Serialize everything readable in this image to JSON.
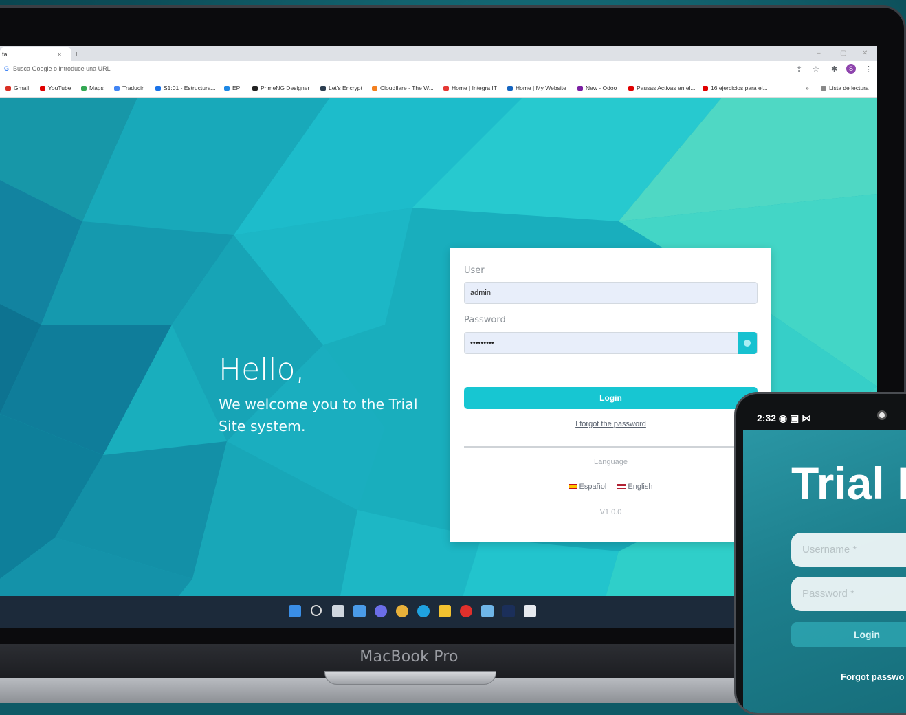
{
  "browser": {
    "tab_title": "fa",
    "tab_close": "×",
    "new_tab": "+",
    "win_min": "–",
    "win_restore": "▢",
    "win_close": "✕",
    "url_placeholder": "Busca Google o introduce una URL",
    "google_letter": "G",
    "profile_initial": "S",
    "bookmarks": [
      {
        "label": "Gmail",
        "color": "#d93025"
      },
      {
        "label": "YouTube",
        "color": "#e00000"
      },
      {
        "label": "Maps",
        "color": "#34a853"
      },
      {
        "label": "Traducir",
        "color": "#4285f4"
      },
      {
        "label": "S1:01 - Estructura...",
        "color": "#1a73e8"
      },
      {
        "label": "EPI",
        "color": "#1e88e5"
      },
      {
        "label": "PrimeNG Designer",
        "color": "#222222"
      },
      {
        "label": "Let's Encrypt",
        "color": "#2c3e50"
      },
      {
        "label": "Cloudflare - The W...",
        "color": "#f38020"
      },
      {
        "label": "Home | Integra IT",
        "color": "#e53935"
      },
      {
        "label": "Home | My Website",
        "color": "#1565c0"
      },
      {
        "label": "New - Odoo",
        "color": "#7b1fa2"
      },
      {
        "label": "Pausas Activas en el...",
        "color": "#e00000"
      },
      {
        "label": "16 ejercicios para el...",
        "color": "#e00000"
      }
    ],
    "reading_list": "Lista de lectura"
  },
  "page": {
    "greeting": "Hello,",
    "welcome": "We welcome you to the Trial Site system."
  },
  "login": {
    "user_label": "User",
    "user_value": "admin",
    "password_label": "Password",
    "password_value": "•••••••••",
    "login_button": "Login",
    "forgot_link": "I forgot the password",
    "language_title": "Language",
    "lang_es": "Español",
    "lang_en": "English",
    "version": "V1.0.0"
  },
  "laptop": {
    "brand": "MacBook Pro"
  },
  "phone": {
    "time": "2:32",
    "title": "Trial I",
    "username_placeholder": "Username *",
    "password_placeholder": "Password *",
    "login_button": "Login",
    "forgot": "Forgot passwo"
  }
}
